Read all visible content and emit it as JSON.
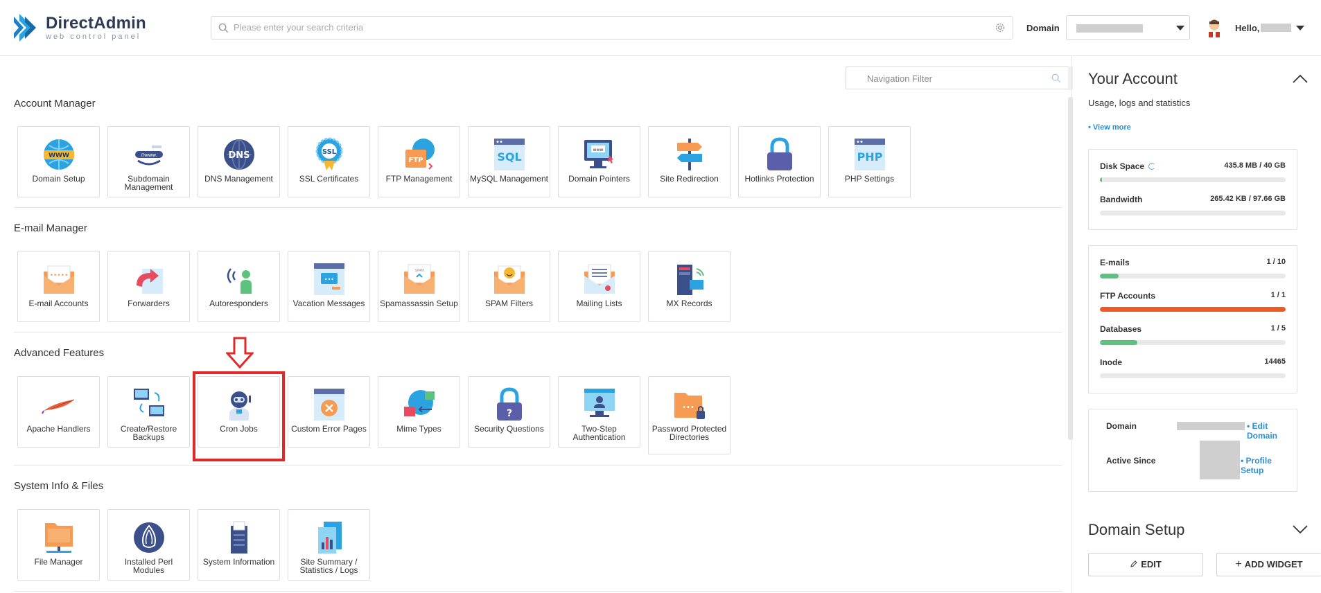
{
  "app": {
    "name": "DirectAdmin",
    "subtitle": "web control panel"
  },
  "header": {
    "search_placeholder": "Please enter your search criteria",
    "domain_label": "Domain",
    "hello": "Hello,"
  },
  "nav_filter_placeholder": "Navigation Filter",
  "sections": {
    "account": {
      "title": "Account Manager",
      "items": [
        {
          "label": "Domain Setup",
          "icon": "globe-www-icon"
        },
        {
          "label": "Subdomain Management",
          "icon": "subdomain-icon"
        },
        {
          "label": "DNS Management",
          "icon": "dns-icon"
        },
        {
          "label": "SSL Certificates",
          "icon": "ssl-badge-icon"
        },
        {
          "label": "FTP Management",
          "icon": "ftp-icon"
        },
        {
          "label": "MySQL Management",
          "icon": "sql-icon"
        },
        {
          "label": "Domain Pointers",
          "icon": "domain-pointers-icon"
        },
        {
          "label": "Site Redirection",
          "icon": "signpost-icon"
        },
        {
          "label": "Hotlinks Protection",
          "icon": "padlock-icon"
        },
        {
          "label": "PHP Settings",
          "icon": "php-icon"
        }
      ]
    },
    "email": {
      "title": "E-mail Manager",
      "items": [
        {
          "label": "E-mail Accounts",
          "icon": "envelope-icon"
        },
        {
          "label": "Forwarders",
          "icon": "forward-icon"
        },
        {
          "label": "Autoresponders",
          "icon": "autoresponder-icon"
        },
        {
          "label": "Vacation Messages",
          "icon": "vacation-icon"
        },
        {
          "label": "Spamassassin Setup",
          "icon": "spam-envelope-icon"
        },
        {
          "label": "SPAM Filters",
          "icon": "spam-filter-icon"
        },
        {
          "label": "Mailing Lists",
          "icon": "mailing-list-icon"
        },
        {
          "label": "MX Records",
          "icon": "mx-records-icon"
        }
      ]
    },
    "advanced": {
      "title": "Advanced Features",
      "items": [
        {
          "label": "Apache Handlers",
          "icon": "apache-feather-icon"
        },
        {
          "label": "Create/Restore Backups",
          "icon": "backup-icon"
        },
        {
          "label": "Cron Jobs",
          "icon": "robot-icon"
        },
        {
          "label": "Custom Error Pages",
          "icon": "error-page-icon"
        },
        {
          "label": "Mime Types",
          "icon": "mime-types-icon"
        },
        {
          "label": "Security Questions",
          "icon": "security-lock-icon"
        },
        {
          "label": "Two-Step Authentication",
          "icon": "two-step-icon"
        },
        {
          "label": "Password Protected Directories",
          "icon": "protected-folder-icon"
        }
      ]
    },
    "system": {
      "title": "System Info & Files",
      "items": [
        {
          "label": "File Manager",
          "icon": "folder-icon"
        },
        {
          "label": "Installed Perl Modules",
          "icon": "perl-onion-icon"
        },
        {
          "label": "System Information",
          "icon": "server-icon"
        },
        {
          "label": "Site Summary / Statistics / Logs",
          "icon": "statistics-icon"
        }
      ]
    }
  },
  "account_panel": {
    "title": "Your Account",
    "subtitle": "Usage, logs and statistics",
    "view_more": "• View more",
    "disk_space": {
      "name": "Disk Space",
      "value": "435.8 MB / 40 GB",
      "fraction": 0.011
    },
    "bandwidth": {
      "name": "Bandwidth",
      "value": "265.42 KB / 97.66 GB",
      "fraction": 0.0
    },
    "emails": {
      "name": "E-mails",
      "value": "1 / 10",
      "fraction": 0.1
    },
    "ftp": {
      "name": "FTP Accounts",
      "value": "1 / 1",
      "fraction": 1.0
    },
    "databases": {
      "name": "Databases",
      "value": "1 / 5",
      "fraction": 0.2
    },
    "inode": {
      "name": "Inode",
      "value": "14465",
      "fraction": 0.0
    },
    "domain_key": "Domain",
    "edit_domain": "• Edit Domain",
    "active_since": "Active Since",
    "profile_setup": "• Profile Setup"
  },
  "domain_setup_panel": {
    "title": "Domain Setup",
    "edit": "EDIT",
    "add_widget": "ADD WIDGET"
  },
  "colors": {
    "green": "#5ec27f",
    "orange": "#ee5a24",
    "blue_link": "#2c8fd6",
    "highlight_red": "#e02a2a"
  }
}
